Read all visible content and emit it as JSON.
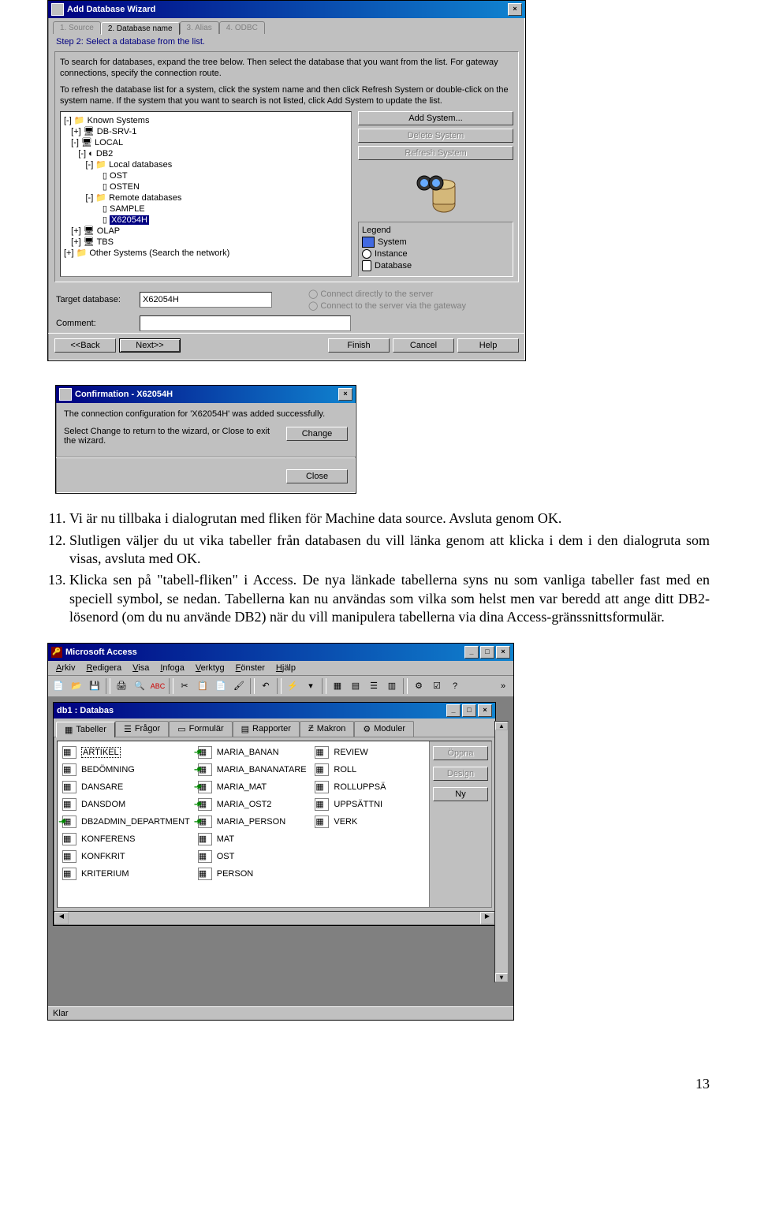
{
  "wizard": {
    "title": "Add Database Wizard",
    "tabs": [
      "1. Source",
      "2. Database name",
      "3. Alias",
      "4. ODBC"
    ],
    "active_tab_index": 1,
    "step_label": "Step 2: Select a database from the list.",
    "instr1": "To search for databases, expand the tree below. Then select the database that you want from the list. For gateway connections, specify the connection route.",
    "instr2": "To refresh the database list for a system, click the system name and then click Refresh System or double-click on the system name. If the system that you want to search is not listed, click Add System to update the list.",
    "tree": [
      {
        "indent": 0,
        "expand": "-",
        "icon": "folder",
        "label": "Known Systems"
      },
      {
        "indent": 1,
        "expand": "+",
        "icon": "sys",
        "label": "DB-SRV-1"
      },
      {
        "indent": 1,
        "expand": "-",
        "icon": "sys",
        "label": "LOCAL"
      },
      {
        "indent": 2,
        "expand": "-",
        "icon": "inst",
        "label": "DB2"
      },
      {
        "indent": 3,
        "expand": "-",
        "icon": "folder",
        "label": "Local databases"
      },
      {
        "indent": 4,
        "expand": "",
        "icon": "db",
        "label": "OST"
      },
      {
        "indent": 4,
        "expand": "",
        "icon": "db",
        "label": "OSTEN"
      },
      {
        "indent": 3,
        "expand": "-",
        "icon": "folder",
        "label": "Remote databases"
      },
      {
        "indent": 4,
        "expand": "",
        "icon": "db",
        "label": "SAMPLE"
      },
      {
        "indent": 4,
        "expand": "",
        "icon": "db",
        "label": "X62054H",
        "selected": true
      },
      {
        "indent": 1,
        "expand": "+",
        "icon": "sys",
        "label": "OLAP"
      },
      {
        "indent": 1,
        "expand": "+",
        "icon": "sys",
        "label": "TBS"
      },
      {
        "indent": 0,
        "expand": "+",
        "icon": "folder",
        "label": "Other Systems (Search the network)"
      }
    ],
    "buttons": {
      "add_system": "Add System...",
      "delete_system": "Delete System",
      "refresh_system": "Refresh System"
    },
    "legend": {
      "title": "Legend",
      "system": "System",
      "instance": "Instance",
      "database": "Database"
    },
    "target_db_label": "Target database:",
    "target_db_value": "X62054H",
    "comment_label": "Comment:",
    "comment_value": "",
    "radio1": "Connect directly to the server",
    "radio2": "Connect to the server via the gateway",
    "footer": {
      "back": "<<Back",
      "next": "Next>>",
      "finish": "Finish",
      "cancel": "Cancel",
      "help": "Help"
    }
  },
  "confirm": {
    "title": "Confirmation - X62054H",
    "msg1": "The connection configuration for 'X62054H' was added successfully.",
    "msg2": "Select Change to return to the wizard, or Close to exit the wizard.",
    "change": "Change",
    "close": "Close"
  },
  "bodytext": {
    "item11": "Vi är nu tillbaka i dialogrutan med fliken för Machine data source. Avsluta genom OK.",
    "item12": "Slutligen väljer du ut vika tabeller från databasen du vill länka genom att klicka i dem i den dialogruta som visas, avsluta med OK.",
    "item13": "Klicka sen på \"tabell-fliken\" i Access. De nya länkade tabellerna syns nu som vanliga tabeller fast med en speciell symbol, se nedan. Tabellerna kan nu användas som vilka som helst men var beredd att ange ditt DB2-lösenord (om du nu använde DB2) när du vill manipulera tabellerna via dina Access-gränssnittsformulär."
  },
  "access": {
    "title": "Microsoft Access",
    "menu": [
      "Arkiv",
      "Redigera",
      "Visa",
      "Infoga",
      "Verktyg",
      "Fönster",
      "Hjälp"
    ],
    "db_title": "db1 : Databas",
    "tabs": [
      {
        "icon": "▦",
        "label": "Tabeller"
      },
      {
        "icon": "☰",
        "label": "Frågor"
      },
      {
        "icon": "▭",
        "label": "Formulär"
      },
      {
        "icon": "▤",
        "label": "Rapporter"
      },
      {
        "icon": "Ƶ",
        "label": "Makron"
      },
      {
        "icon": "⚙",
        "label": "Moduler"
      }
    ],
    "cols": [
      [
        {
          "label": "ARTIKEL",
          "link": false,
          "sel": true
        },
        {
          "label": "BEDÖMNING",
          "link": false
        },
        {
          "label": "DANSARE",
          "link": false
        },
        {
          "label": "DANSDOM",
          "link": false
        },
        {
          "label": "DB2ADMIN_DEPARTMENT",
          "link": true
        },
        {
          "label": "KONFERENS",
          "link": false
        },
        {
          "label": "KONFKRIT",
          "link": false
        },
        {
          "label": "KRITERIUM",
          "link": false
        }
      ],
      [
        {
          "label": "MARIA_BANAN",
          "link": true
        },
        {
          "label": "MARIA_BANANATARE",
          "link": true
        },
        {
          "label": "MARIA_MAT",
          "link": true
        },
        {
          "label": "MARIA_OST2",
          "link": true
        },
        {
          "label": "MARIA_PERSON",
          "link": true
        },
        {
          "label": "MAT",
          "link": false
        },
        {
          "label": "OST",
          "link": false
        },
        {
          "label": "PERSON",
          "link": false
        }
      ],
      [
        {
          "label": "REVIEW",
          "link": false
        },
        {
          "label": "ROLL",
          "link": false
        },
        {
          "label": "ROLLUPPSÄ",
          "link": false
        },
        {
          "label": "UPPSÄTTNI",
          "link": false
        },
        {
          "label": "VERK",
          "link": false
        }
      ]
    ],
    "side": {
      "open": "Öppna",
      "design": "Design",
      "new": "Ny"
    },
    "status": "Klar"
  },
  "page_number": "13"
}
